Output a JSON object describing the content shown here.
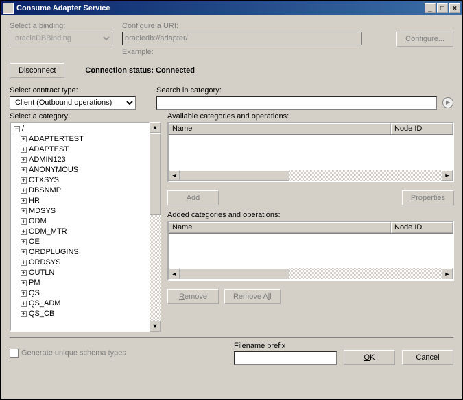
{
  "window": {
    "title": "Consume Adapter Service"
  },
  "binding": {
    "label_select": "Select a ",
    "label_underline": "b",
    "label_rest": "inding:",
    "value": "oracleDBBinding"
  },
  "uri": {
    "label_configure": "Configure a ",
    "label_underline": "U",
    "label_rest": "RI:",
    "value": "oracledb://adapter/",
    "example_label": "Example:"
  },
  "buttons": {
    "configure": "Configure...",
    "disconnect": "Disconnect",
    "add": "Add",
    "properties": "Properties",
    "remove": "Remove",
    "remove_all": "Remove All",
    "ok": "OK",
    "cancel": "Cancel"
  },
  "status": {
    "label": "Connection status: ",
    "value": "Connected"
  },
  "contract": {
    "label": "Select contract type:",
    "value": "Client (Outbound operations)"
  },
  "search": {
    "label": "Search in category:",
    "value": ""
  },
  "category": {
    "label": "Select a category:",
    "root": "/",
    "items": [
      "ADAPTERTEST",
      "ADAPTEST",
      "ADMIN123",
      "ANONYMOUS",
      "CTXSYS",
      "DBSNMP",
      "HR",
      "MDSYS",
      "ODM",
      "ODM_MTR",
      "OE",
      "ORDPLUGINS",
      "ORDSYS",
      "OUTLN",
      "PM",
      "QS",
      "QS_ADM",
      "QS_CB"
    ]
  },
  "available": {
    "label": "Available categories and operations:",
    "col_name": "Name",
    "col_id": "Node ID"
  },
  "added": {
    "label": "Added categories and operations:",
    "col_name": "Name",
    "col_id": "Node ID"
  },
  "footer": {
    "checkbox_label": "Generate unique schema types",
    "filename_label": "Filename prefix",
    "filename_value": ""
  }
}
